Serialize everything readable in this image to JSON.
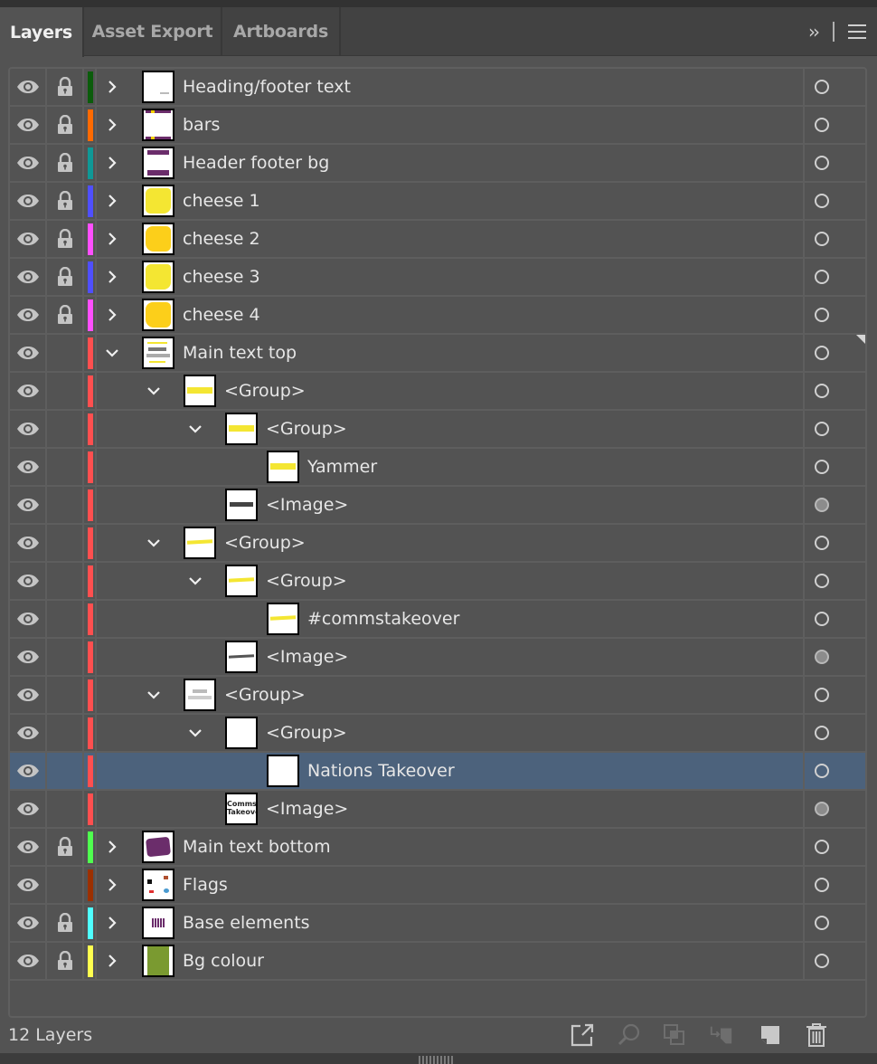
{
  "tabs": [
    {
      "label": "Layers",
      "active": true
    },
    {
      "label": "Asset Export",
      "active": false
    },
    {
      "label": "Artboards",
      "active": false
    }
  ],
  "panel_controls": {
    "collapse_icon": "double-chevron-right-icon",
    "collapse_glyph": "››",
    "menu_icon": "hamburger-menu-icon"
  },
  "layers": [
    {
      "name": "Heading/footer text",
      "depth": 0,
      "expander": "collapsed",
      "locked": true,
      "visible": true,
      "color": "#0b5c0b",
      "thumb": "heading",
      "target": "empty"
    },
    {
      "name": "bars",
      "depth": 0,
      "expander": "collapsed",
      "locked": true,
      "visible": true,
      "color": "#ff6a00",
      "thumb": "bars",
      "target": "empty"
    },
    {
      "name": "Header footer bg",
      "depth": 0,
      "expander": "collapsed",
      "locked": true,
      "visible": true,
      "color": "#0f9896",
      "thumb": "headerbg",
      "target": "empty"
    },
    {
      "name": "cheese 1",
      "depth": 0,
      "expander": "collapsed",
      "locked": true,
      "visible": true,
      "color": "#4f4fff",
      "thumb": "cheese-light",
      "target": "empty"
    },
    {
      "name": "cheese 2",
      "depth": 0,
      "expander": "collapsed",
      "locked": true,
      "visible": true,
      "color": "#ff4fff",
      "thumb": "cheese-dark",
      "target": "empty"
    },
    {
      "name": "cheese 3",
      "depth": 0,
      "expander": "collapsed",
      "locked": true,
      "visible": true,
      "color": "#4f4fff",
      "thumb": "cheese-light",
      "target": "empty"
    },
    {
      "name": "cheese 4",
      "depth": 0,
      "expander": "collapsed",
      "locked": true,
      "visible": true,
      "color": "#ff4fff",
      "thumb": "cheese-dark",
      "target": "empty"
    },
    {
      "name": "Main text top",
      "depth": 0,
      "expander": "expanded",
      "locked": false,
      "visible": true,
      "color": "#ff4f4f",
      "thumb": "maintext",
      "target": "empty",
      "selected_art_indicator": true
    },
    {
      "name": "<Group>",
      "depth": 1,
      "expander": "expanded",
      "locked": false,
      "visible": true,
      "color": "#ff4f4f",
      "thumb": "yammer-yellow",
      "target": "empty"
    },
    {
      "name": "<Group>",
      "depth": 2,
      "expander": "expanded",
      "locked": false,
      "visible": true,
      "color": "#ff4f4f",
      "thumb": "yammer-yellow",
      "target": "empty"
    },
    {
      "name": "Yammer",
      "depth": 3,
      "expander": "none",
      "locked": false,
      "visible": true,
      "color": "#ff4f4f",
      "thumb": "yammer-yellow",
      "target": "empty"
    },
    {
      "name": "<Image>",
      "depth": 2,
      "expander": "none",
      "locked": false,
      "visible": true,
      "color": "#ff4f4f",
      "thumb": "yammer-black",
      "target": "filled"
    },
    {
      "name": "<Group>",
      "depth": 1,
      "expander": "expanded",
      "locked": false,
      "visible": true,
      "color": "#ff4f4f",
      "thumb": "comms-yellow",
      "target": "empty"
    },
    {
      "name": "<Group>",
      "depth": 2,
      "expander": "expanded",
      "locked": false,
      "visible": true,
      "color": "#ff4f4f",
      "thumb": "comms-yellow",
      "target": "empty"
    },
    {
      "name": "#commstakeover",
      "depth": 3,
      "expander": "none",
      "locked": false,
      "visible": true,
      "color": "#ff4f4f",
      "thumb": "comms-yellow",
      "target": "empty"
    },
    {
      "name": "<Image>",
      "depth": 2,
      "expander": "none",
      "locked": false,
      "visible": true,
      "color": "#ff4f4f",
      "thumb": "comms-black",
      "target": "filled"
    },
    {
      "name": "<Group>",
      "depth": 1,
      "expander": "expanded",
      "locked": false,
      "visible": true,
      "color": "#ff4f4f",
      "thumb": "takeover-outline",
      "target": "empty"
    },
    {
      "name": "<Group>",
      "depth": 2,
      "expander": "expanded",
      "locked": false,
      "visible": true,
      "color": "#ff4f4f",
      "thumb": "blank",
      "target": "empty"
    },
    {
      "name": "Nations Takeover",
      "depth": 3,
      "expander": "none",
      "locked": false,
      "visible": true,
      "color": "#ff4f4f",
      "thumb": "blank",
      "target": "empty",
      "selected": true
    },
    {
      "name": "<Image>",
      "depth": 2,
      "expander": "none",
      "locked": false,
      "visible": true,
      "color": "#ff4f4f",
      "thumb": "comms-takeover",
      "target": "filled"
    },
    {
      "name": "Main text bottom",
      "depth": 0,
      "expander": "collapsed",
      "locked": true,
      "visible": true,
      "color": "#4fff4f",
      "thumb": "purple-scribble",
      "target": "empty"
    },
    {
      "name": "Flags",
      "depth": 0,
      "expander": "collapsed",
      "locked": false,
      "visible": true,
      "color": "#9c3000",
      "thumb": "flags",
      "target": "empty"
    },
    {
      "name": "Base elements",
      "depth": 0,
      "expander": "collapsed",
      "locked": true,
      "visible": true,
      "color": "#4fffff",
      "thumb": "base",
      "target": "empty"
    },
    {
      "name": "Bg colour",
      "depth": 0,
      "expander": "collapsed",
      "locked": true,
      "visible": true,
      "color": "#ffff4f",
      "thumb": "bg-green",
      "target": "empty"
    }
  ],
  "footer": {
    "layer_count": "12 Layers",
    "actions": [
      {
        "name": "export-for-screens-button",
        "icon": "export-arrow-icon",
        "enabled": true
      },
      {
        "name": "locate-object-button",
        "icon": "search-icon",
        "enabled": false
      },
      {
        "name": "make-clipping-mask-button",
        "icon": "clipping-mask-icon",
        "enabled": false
      },
      {
        "name": "create-sublayer-button",
        "icon": "sublayer-icon",
        "enabled": false
      },
      {
        "name": "create-new-layer-button",
        "icon": "new-layer-icon",
        "enabled": true
      },
      {
        "name": "delete-layer-button",
        "icon": "trash-icon",
        "enabled": true
      }
    ]
  }
}
